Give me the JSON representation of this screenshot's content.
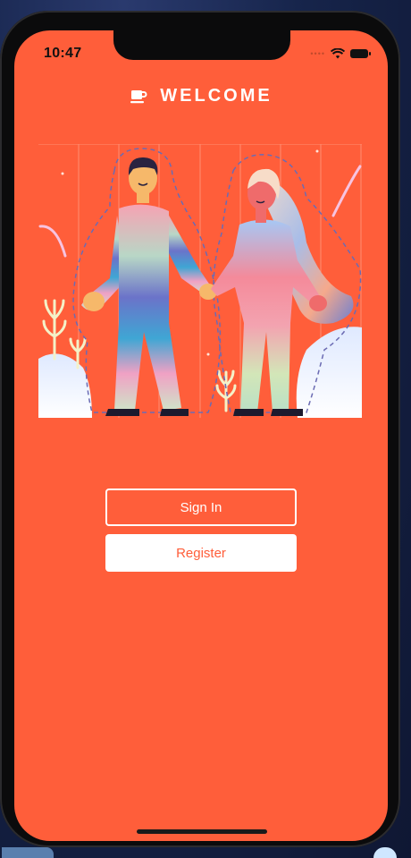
{
  "status_bar": {
    "time": "10:47",
    "signal_icon": "signal-dots-icon",
    "wifi_icon": "wifi-icon",
    "battery_icon": "battery-icon"
  },
  "header": {
    "icon": "coffee-cup-icon",
    "title": "WELCOME"
  },
  "illustration": {
    "icon": "couple-holding-hands-illustration"
  },
  "buttons": {
    "sign_in_label": "Sign In",
    "register_label": "Register"
  },
  "colors": {
    "background": "#ff5e3a",
    "button_text_primary": "#ffffff",
    "button_text_secondary": "#ff5e3a"
  }
}
